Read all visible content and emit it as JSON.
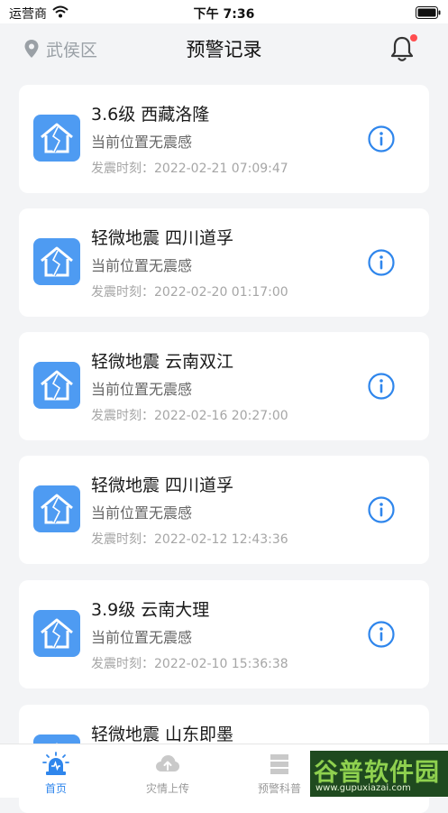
{
  "status_bar": {
    "carrier": "运营商",
    "time": "下午 7:36"
  },
  "header": {
    "location": "武侯区",
    "title": "预警记录"
  },
  "records": [
    {
      "title": "3.6级 西藏洛隆",
      "status": "当前位置无震感",
      "time": "发震时刻：2022-02-21 07:09:47"
    },
    {
      "title": "轻微地震 四川道孚",
      "status": "当前位置无震感",
      "time": "发震时刻：2022-02-20 01:17:00"
    },
    {
      "title": "轻微地震 云南双江",
      "status": "当前位置无震感",
      "time": "发震时刻：2022-02-16 20:27:00"
    },
    {
      "title": "轻微地震 四川道孚",
      "status": "当前位置无震感",
      "time": "发震时刻：2022-02-12 12:43:36"
    },
    {
      "title": "3.9级 云南大理",
      "status": "当前位置无震感",
      "time": "发震时刻：2022-02-10 15:36:38"
    },
    {
      "title": "轻微地震 山东即墨",
      "status": "",
      "time": ""
    }
  ],
  "tabs": [
    {
      "label": "首页",
      "icon": "alarm-icon"
    },
    {
      "label": "灾情上传",
      "icon": "cloud-upload-icon"
    },
    {
      "label": "预警科普",
      "icon": "book-icon"
    }
  ],
  "watermark": {
    "main": "谷普软件园",
    "sub": "www.gupuxiazai.com"
  },
  "colors": {
    "accent": "#2f86ec",
    "quake_icon_bg": "#4e9bf2",
    "badge": "#ff4d4f"
  }
}
